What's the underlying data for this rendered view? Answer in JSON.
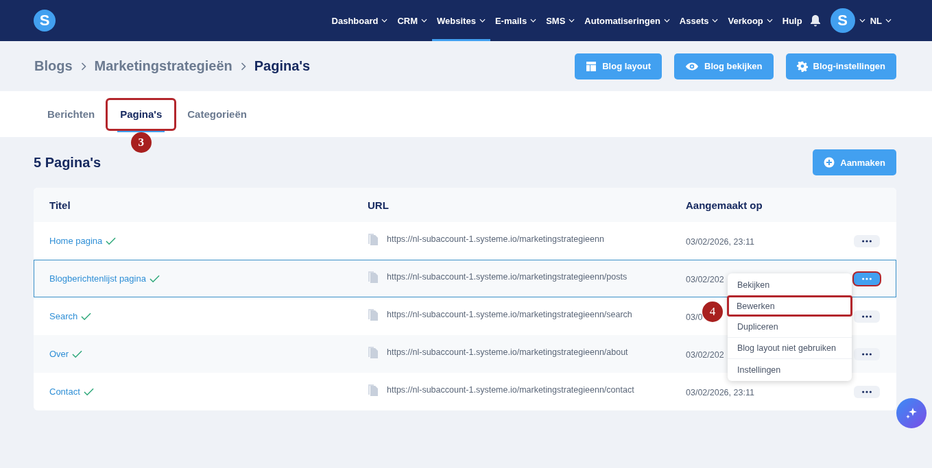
{
  "nav": {
    "items": [
      {
        "label": "Dashboard",
        "dropdown": true,
        "selected": false
      },
      {
        "label": "CRM",
        "dropdown": true,
        "selected": false
      },
      {
        "label": "Websites",
        "dropdown": true,
        "selected": true
      },
      {
        "label": "E-mails",
        "dropdown": true,
        "selected": false
      },
      {
        "label": "SMS",
        "dropdown": true,
        "selected": false
      },
      {
        "label": "Automatiseringen",
        "dropdown": true,
        "selected": false
      },
      {
        "label": "Assets",
        "dropdown": true,
        "selected": false
      },
      {
        "label": "Verkoop",
        "dropdown": true,
        "selected": false
      },
      {
        "label": "Hulp",
        "dropdown": false,
        "selected": false
      }
    ],
    "logo": "S",
    "avatar": "S",
    "language": "NL"
  },
  "breadcrumb": [
    "Blogs",
    "Marketingstrategieën",
    "Pagina's"
  ],
  "header_buttons": [
    {
      "label": "Blog layout"
    },
    {
      "label": "Blog bekijken"
    },
    {
      "label": "Blog-instellingen"
    }
  ],
  "tabs": [
    {
      "label": "Berichten",
      "selected": false,
      "highlighted": false
    },
    {
      "label": "Pagina's",
      "selected": true,
      "highlighted": true,
      "step": "3"
    },
    {
      "label": "Categorieën",
      "selected": false,
      "highlighted": false
    }
  ],
  "count_title": "5 Pagina's",
  "create_button": "Aanmaken",
  "table": {
    "columns": [
      "Titel",
      "URL",
      "Aangemaakt op"
    ],
    "rows": [
      {
        "title": "Home pagina",
        "url": "https://nl-subaccount-1.systeme.io/marketingstrategieenn",
        "created": "03/02/2026, 23:11",
        "selected": false,
        "menu_open": false
      },
      {
        "title": "Blogberichtenlijst pagina",
        "url": "https://nl-subaccount-1.systeme.io/marketingstrategieenn/posts",
        "created": "03/02/202",
        "selected": true,
        "menu_open": true
      },
      {
        "title": "Search",
        "url": "https://nl-subaccount-1.systeme.io/marketingstrategieenn/search",
        "created": "03/0",
        "selected": false,
        "menu_open": false
      },
      {
        "title": "Over",
        "url": "https://nl-subaccount-1.systeme.io/marketingstrategieenn/about",
        "created": "03/02/202",
        "selected": false,
        "menu_open": false
      },
      {
        "title": "Contact",
        "url": "https://nl-subaccount-1.systeme.io/marketingstrategieenn/contact",
        "created": "03/02/2026, 23:11",
        "selected": false,
        "menu_open": false
      }
    ]
  },
  "row_menu": {
    "step": "4",
    "items": [
      {
        "label": "Bekijken",
        "highlighted": false
      },
      {
        "label": "Bewerken",
        "highlighted": true
      },
      {
        "label": "Dupliceren",
        "highlighted": false
      },
      {
        "label": "Blog layout niet gebruiken",
        "highlighted": false
      },
      {
        "label": "Instellingen",
        "highlighted": false
      }
    ]
  }
}
